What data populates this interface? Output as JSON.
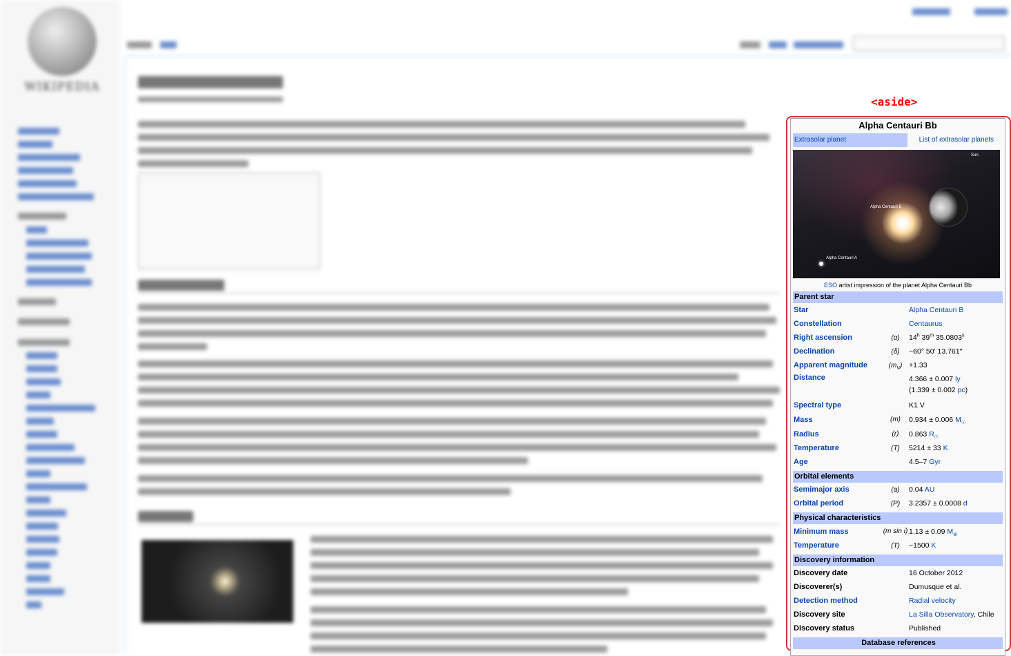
{
  "annotation_label": "<aside>",
  "infobox": {
    "title": "Alpha Centauri Bb",
    "subheader_left": "Extrasolar planet",
    "subheader_right": "List of extrasolar planets",
    "image_labels": {
      "sun": "Sun",
      "alpha_b": "Alpha Centauri B",
      "alpha_a": "Alpha Centauri A"
    },
    "caption_link": "ESO",
    "caption_text": " artist impression of the planet Alpha Centauri Bb",
    "sections": {
      "parent_star": "Parent star",
      "orbital": "Orbital elements",
      "physical": "Physical characteristics",
      "discovery": "Discovery information",
      "database": "Database references"
    },
    "parent_star_rows": {
      "star": {
        "label": "Star",
        "value": "Alpha Centauri B"
      },
      "constellation": {
        "label": "Constellation",
        "value": "Centaurus"
      },
      "ra": {
        "label": "Right ascension",
        "symbol": "(α)",
        "h": "14",
        "h_unit": "h",
        "m": " 39",
        "m_unit": "m",
        "s": " 35.0803",
        "s_unit": "s"
      },
      "dec": {
        "label": "Declination",
        "symbol": "(δ)",
        "value": "−60° 50′ 13.761″"
      },
      "mag": {
        "label": "Apparent magnitude",
        "symbol": "(m",
        "symbol_sub": "V",
        "symbol_end": ")",
        "value": "+1.33"
      },
      "distance": {
        "label": "Distance",
        "value1": "4.366 ± 0.007 ",
        "unit1": "ly",
        "value2a": "(1.339 ± 0.002 ",
        "unit2": "pc",
        "value2b": ")"
      },
      "spectral": {
        "label": "Spectral type",
        "value": "K1 V"
      },
      "mass": {
        "label": "Mass",
        "symbol": "(m)",
        "value": "0.934 ± 0.006 ",
        "unit": "M",
        "unit_sub": "☉"
      },
      "radius": {
        "label": "Radius",
        "symbol": "(r)",
        "value": "0.863 ",
        "unit": "R",
        "unit_sub": "☉"
      },
      "temperature": {
        "label": "Temperature",
        "symbol": "(T)",
        "value": "5214 ± 33 ",
        "unit": "K"
      },
      "age": {
        "label": "Age",
        "value": "4.5–7 ",
        "unit": "Gyr"
      }
    },
    "orbital_rows": {
      "semimajor": {
        "label": "Semimajor axis",
        "symbol": "(a)",
        "value": "0.04 ",
        "unit": "AU"
      },
      "period": {
        "label": "Orbital period",
        "symbol": "(P)",
        "value": "3.2357 ± 0.0008 ",
        "unit": "d"
      }
    },
    "physical_rows": {
      "min_mass": {
        "label": "Minimum mass",
        "symbol": "(m sin i)",
        "value": "1.13 ± 0.09 ",
        "unit": "M",
        "unit_sub": "⊕"
      },
      "temperature": {
        "label": "Temperature",
        "symbol": "(T)",
        "value": "~1500 ",
        "unit": "K"
      }
    },
    "discovery_rows": {
      "date": {
        "label": "Discovery date",
        "value": "16 October 2012"
      },
      "discoverers": {
        "label": "Discoverer(s)",
        "value": "Dumusque et al."
      },
      "method": {
        "label": "Detection method",
        "value": "Radial velocity"
      },
      "site": {
        "label": "Discovery site",
        "value_link": "La Silla Observatory",
        "value_rest": ", Chile"
      },
      "status": {
        "label": "Discovery status",
        "value": "Published"
      }
    }
  },
  "colors": {
    "accent": "#e03030",
    "section_bg": "#b9c9fe",
    "link": "#0645ad"
  }
}
